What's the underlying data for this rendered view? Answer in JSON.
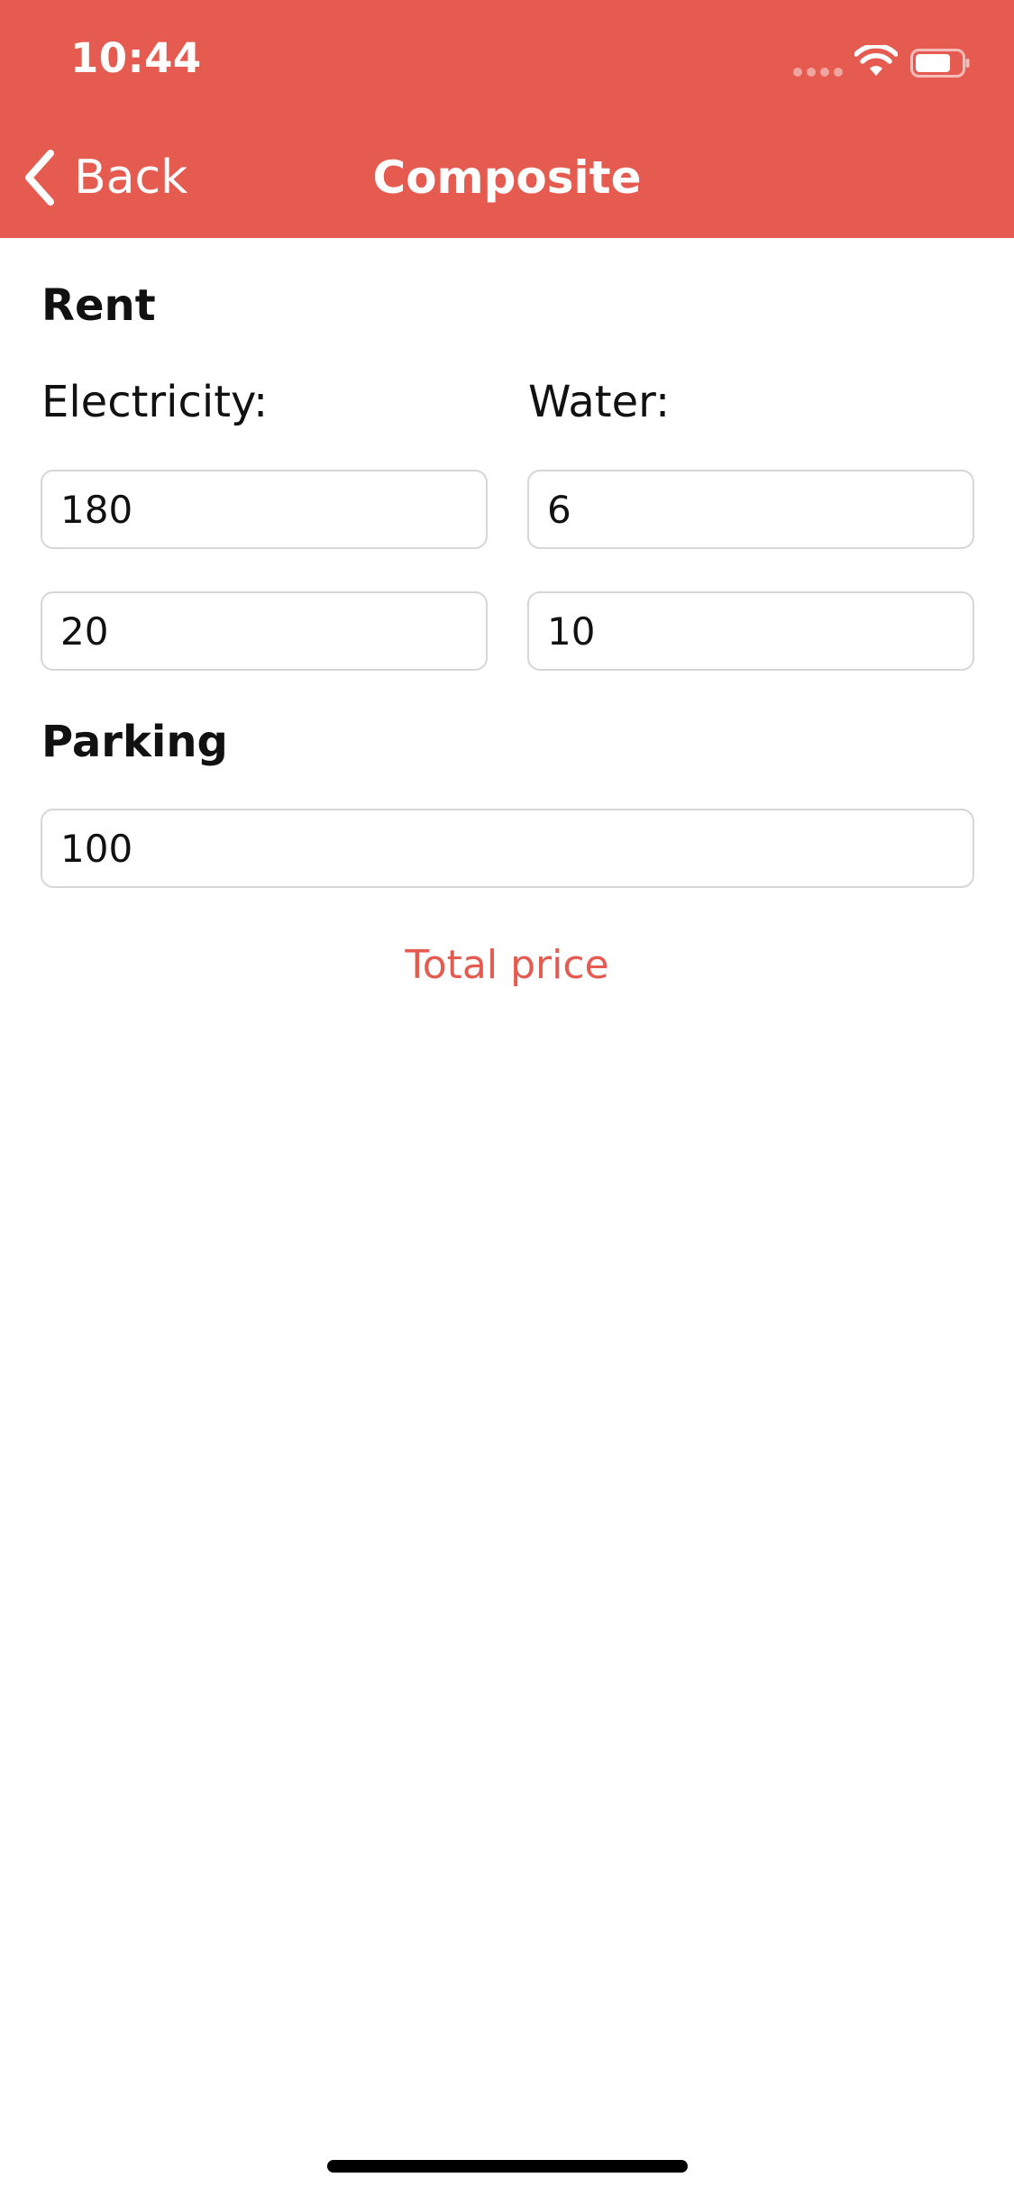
{
  "status_bar": {
    "time": "10:44"
  },
  "nav": {
    "back_label": "Back",
    "title": "Composite"
  },
  "rent": {
    "section_title": "Rent",
    "electricity_label": "Electricity:",
    "water_label": "Water:",
    "electricity_values": [
      "180",
      "20"
    ],
    "water_values": [
      "6",
      "10"
    ]
  },
  "parking": {
    "section_title": "Parking",
    "value": "100"
  },
  "total_price_label": "Total price",
  "colors": {
    "accent": "#E55B50",
    "background": "#FFFFFF",
    "text": "#111111",
    "input_border": "#D6D6D6"
  },
  "icons": {
    "back": "chevron-left-icon",
    "signal": "cellular-signal-icon",
    "wifi": "wifi-icon",
    "battery": "battery-icon"
  }
}
